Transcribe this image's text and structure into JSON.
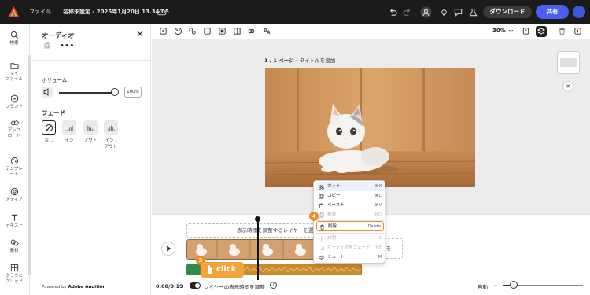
{
  "topbar": {
    "file_menu": "ファイル",
    "doc_title": "名称未設定 - 2025年1月20日 13.34.05",
    "download": "ダウンロード",
    "share": "共有"
  },
  "rail": {
    "items": [
      {
        "label": "検索",
        "icon": "search-icon"
      },
      {
        "label": "マイ\nファイル",
        "icon": "folder-icon"
      },
      {
        "label": "ブランド",
        "icon": "brand-icon"
      },
      {
        "label": "アップ\nロード",
        "icon": "upload-icon"
      },
      {
        "label": "テンプレ\nート",
        "icon": "template-icon"
      },
      {
        "label": "メディア",
        "icon": "media-icon"
      },
      {
        "label": "テキスト",
        "icon": "text-icon"
      },
      {
        "label": "素材",
        "icon": "elements-icon"
      },
      {
        "label": "グラフと\nグリッド",
        "icon": "grid-icon"
      }
    ]
  },
  "panel": {
    "title": "オーディオ",
    "volume_label": "ボリューム",
    "volume_value": "100%",
    "volume_level": 1.0,
    "fade_label": "フェード",
    "fade_options": [
      {
        "label": "なし",
        "selected": true
      },
      {
        "label": "イン",
        "selected": false
      },
      {
        "label": "アウト",
        "selected": false
      },
      {
        "label": "イン /\nアウト",
        "selected": false
      }
    ],
    "powered_prefix": "Powered by",
    "powered_brand": "Adobe Audition"
  },
  "canvas": {
    "zoom": "30%",
    "page_prefix": "1 / 1 ページ -",
    "page_title_placeholder": "タイトルを追加"
  },
  "timeline": {
    "drop_hint": "表示時間を調整するレイヤーを選択",
    "drop_hint_2": "を",
    "time": "0:08/0:19",
    "toggle_label": "レイヤーの表示時間を調整",
    "auto": "自動",
    "click_label": "click",
    "badge_3": "3",
    "badge_4": "4"
  },
  "context_menu": {
    "items": [
      {
        "label": "カット",
        "key": "⌘X",
        "icon": "cut-icon",
        "state": "highlight"
      },
      {
        "label": "コピー",
        "key": "⌘C",
        "icon": "copy-icon",
        "state": "normal"
      },
      {
        "label": "ペースト",
        "key": "⌘V",
        "icon": "paste-icon",
        "state": "normal"
      },
      {
        "label": "複製",
        "key": "⌘D",
        "icon": "duplicate-icon",
        "state": "disabled"
      },
      {
        "label": "削除",
        "key": "Delete",
        "icon": "trash-icon",
        "state": "focus"
      },
      {
        "label": "分割",
        "key": "S",
        "icon": "split-icon",
        "state": "disabled"
      },
      {
        "label": "オーディオをフェード",
        "key": "⌘F",
        "icon": "fade-icon",
        "state": "disabled"
      },
      {
        "label": "ミュート",
        "key": "M",
        "icon": "mute-icon",
        "state": "normal"
      }
    ]
  },
  "colors": {
    "accent": "#4b5ff2",
    "badge": "#f08c22",
    "audio": "#c98a2a",
    "topbar": "#1b1b1b"
  }
}
